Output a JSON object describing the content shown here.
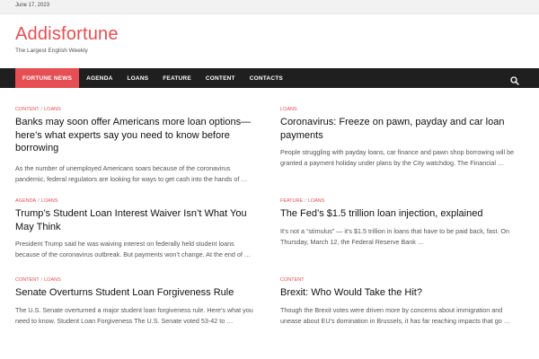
{
  "topbar": {
    "date": "June 17, 2023"
  },
  "branding": {
    "site_title": "Addisfortune",
    "tagline": "The Largest English Weekly"
  },
  "nav": {
    "items": [
      {
        "label": "FORTUNE NEWS",
        "active": true
      },
      {
        "label": "AGENDA",
        "active": false
      },
      {
        "label": "LOANS",
        "active": false
      },
      {
        "label": "FEATURE",
        "active": false
      },
      {
        "label": "CONTENT",
        "active": false
      },
      {
        "label": "CONTACTS",
        "active": false
      }
    ],
    "search_icon": "search-icon"
  },
  "colors": {
    "accent": "#e54e53",
    "nav_bg": "#1f1f1f"
  },
  "posts": [
    {
      "categories": [
        "CONTENT",
        "LOANS"
      ],
      "title": "Banks may soon offer Americans more loan options—here’s what experts say you need to know before borrowing",
      "excerpt": "As the number of unemployed Americans soars because of the coronavirus pandemic, federal regulators are looking for ways to get cash into the hands of …"
    },
    {
      "categories": [
        "LOANS"
      ],
      "title": "Coronavirus: Freeze on pawn, payday and car loan payments",
      "excerpt": "People struggling with payday loans, car finance and pawn shop borrowing will be granted a payment holiday under plans by the City watchdog. The Financial …"
    },
    {
      "categories": [
        "AGENDA",
        "LOANS"
      ],
      "title": "Trump’s Student Loan Interest Waiver Isn’t What You May Think",
      "excerpt": "President Trump said he was waiving interest on federally held student loans because of the coronavirus outbreak. But payments won’t change. At the end of …"
    },
    {
      "categories": [
        "FEATURE",
        "LOANS"
      ],
      "title": "The Fed’s $1.5 trillion loan injection, explained",
      "excerpt": "It’s not a “stimulus” — it’s $1.5 trillion in loans that have to be paid back, fast. On Thursday, March 12, the Federal Reserve Bank …"
    },
    {
      "categories": [
        "CONTENT",
        "LOANS"
      ],
      "title": "Senate Overturns Student Loan Forgiveness Rule",
      "excerpt": "The U.S. Senate overturned a major student loan forgiveness rule. Here’s what you need to know. Student Loan Forgiveness The U.S. Senate voted 53-42 to …"
    },
    {
      "categories": [
        "CONTENT"
      ],
      "title": "Brexit: Who Would Take the Hit?",
      "excerpt": "Though the Brexit votes were driven more by concerns about immigration and unease about EU’s domination in Brussels, it has far reaching impacts that go …"
    }
  ]
}
